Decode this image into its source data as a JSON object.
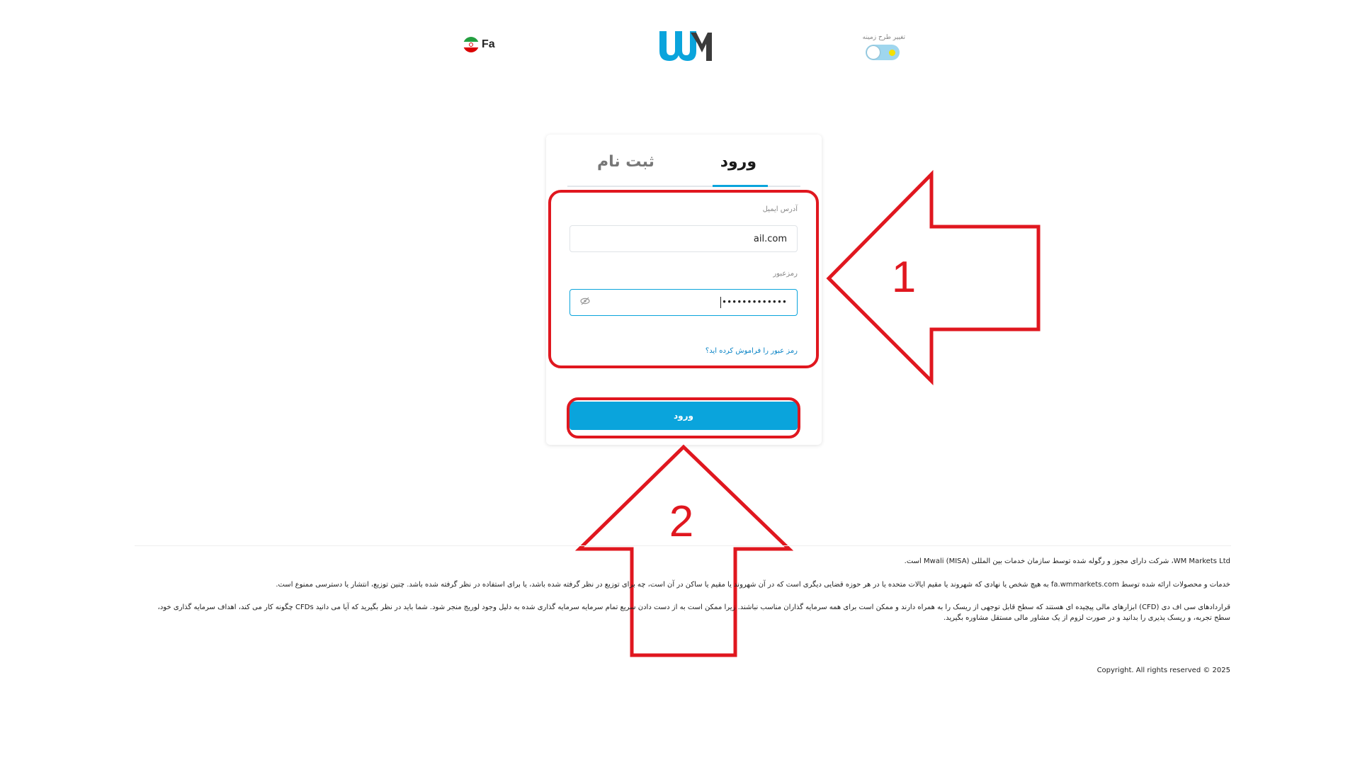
{
  "header": {
    "language_label": "Fa",
    "theme_toggle_label": "تغییر طرح زمینه"
  },
  "colors": {
    "accent": "#0aa4dc",
    "annotation_red": "#e0171f",
    "logo_blue": "#0aa4dc",
    "logo_dark": "#3b3b3b"
  },
  "icons": {
    "language": "iran-flag-icon",
    "logo": "wm-logo",
    "theme": "sun-toggle-icon",
    "password_visibility": "eye-slash-icon"
  },
  "tabs": {
    "login": "ورود",
    "register": "ثبت نام"
  },
  "form": {
    "email_label": "آدرس ایمیل",
    "email_value": "ail.com",
    "password_label": "رمزعبور",
    "password_value": "•••••••••••••",
    "forgot_link": "رمز عبور را فراموش کرده اید؟",
    "submit_label": "ورود"
  },
  "annotations": {
    "arrow_1_label": "1",
    "arrow_2_label": "2"
  },
  "footer": {
    "line1": "WM Markets Ltd، شرکت دارای مجوز و رگوله شده توسط سازمان خدمات بین المللی Mwali (MISA) است.",
    "line2": "خدمات و محصولات ارائه شده توسط fa.wmmarkets.com به هیچ شخص یا نهادی که شهروند یا مقیم ایالات متحده یا در هر حوزه قضایی دیگری است که در آن شهروند یا مقیم یا ساکن در آن است، چه برای توزیع در نظر گرفته شده باشد، یا برای استفاده در نظر گرفته شده باشد. چنین توزیع، انتشار یا دسترسی ممنوع است.",
    "line3": "قراردادهای سی اف دی (CFD) ابزارهای مالی پیچیده ای هستند که سطح قابل توجهی از ریسک را به همراه دارند و ممکن است برای همه سرمایه گذاران مناسب نباشند. زیرا ممکن است به از دست دادن سریع تمام سرمایه سرمایه گذاری شده به دلیل وجود لوریج منجر شود. شما باید در نظر بگیرید که آیا می دانید CFDs چگونه کار می کند، اهداف سرمایه گذاری خود، سطح تجربه، و ریسک پذیری را بدانید و در صورت لزوم از یک مشاور مالی مستقل مشاوره بگیرید.",
    "copyright": "Copyright. All rights reserved © 2025"
  }
}
